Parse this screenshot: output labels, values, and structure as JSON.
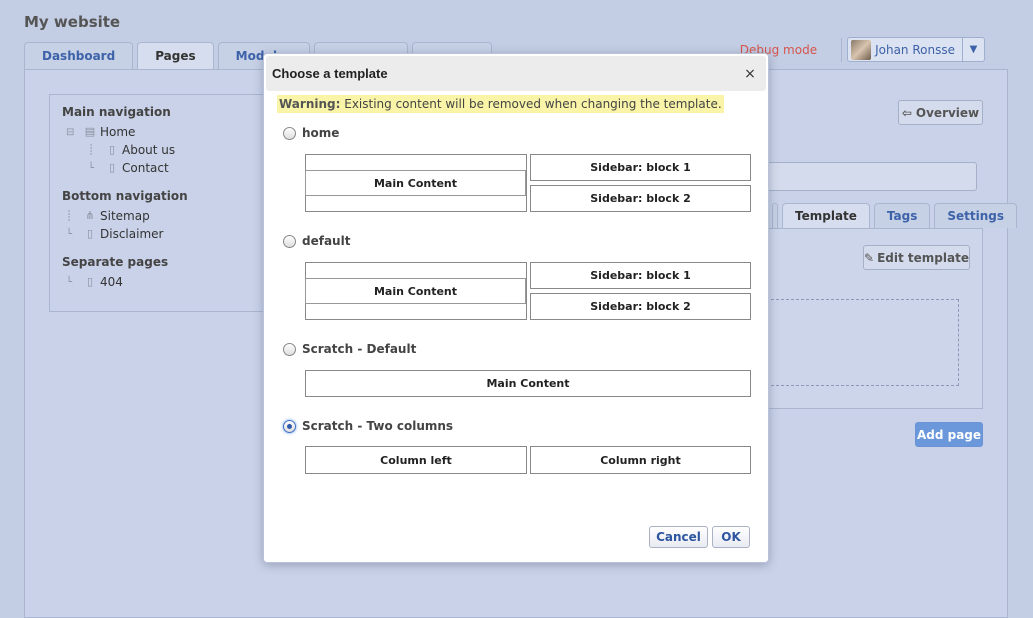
{
  "site": {
    "title": "My website"
  },
  "tabs": [
    "Dashboard",
    "Pages",
    "Modules",
    "",
    ""
  ],
  "header": {
    "debug_mode": "Debug mode",
    "user_name": "Johan Ronsse",
    "caret": "▼"
  },
  "tree": {
    "main_navigation": {
      "title": "Main navigation",
      "items": [
        "Home",
        "About us",
        "Contact"
      ]
    },
    "bottom_navigation": {
      "title": "Bottom navigation",
      "items": [
        "Sitemap",
        "Disclaimer"
      ]
    },
    "separate_pages": {
      "title": "Separate pages",
      "items": [
        "404"
      ]
    }
  },
  "right": {
    "overview_label": "Overview",
    "tabs": [
      "Template",
      "Tags",
      "Settings"
    ],
    "edit_template_label": "Edit template",
    "add_page_label": "Add page"
  },
  "modal": {
    "title": "Choose a template",
    "close": "×",
    "warning_label": "Warning:",
    "warning_text": " Existing content will be removed when changing the template.",
    "templates": [
      {
        "name": "home",
        "checked": false,
        "blocks": [
          "Main Content",
          "Sidebar: block 1",
          "Sidebar: block 2"
        ]
      },
      {
        "name": "default",
        "checked": false,
        "blocks": [
          "Main Content",
          "Sidebar: block 1",
          "Sidebar: block 2"
        ]
      },
      {
        "name": "Scratch - Default",
        "checked": false,
        "blocks": [
          "Main Content"
        ]
      },
      {
        "name": "Scratch - Two columns",
        "checked": true,
        "blocks": [
          "Column left",
          "Column right"
        ]
      }
    ],
    "cancel_label": "Cancel",
    "ok_label": "OK"
  },
  "colors": {
    "background": "#c3cde3",
    "link": "#3d62a8",
    "debug": "#d6554c",
    "warning_bg": "#f9f4a8",
    "primary_button": "#6b97db"
  }
}
